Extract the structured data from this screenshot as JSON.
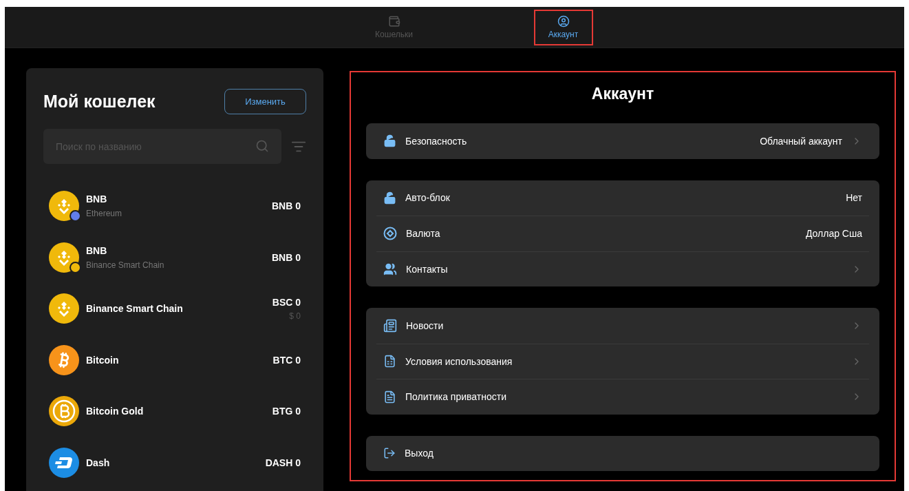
{
  "nav_tabs": [
    {
      "label": "Кошельки",
      "selected": false,
      "highlighted": false
    },
    {
      "label": "Аккаунт",
      "selected": true,
      "highlighted": true
    }
  ],
  "wallet": {
    "title": "Мой кошелек",
    "edit_button": "Изменить",
    "search": {
      "placeholder": "Поиск по названию"
    },
    "coins": [
      {
        "kind": "bnb-eth",
        "name": "BNB",
        "network": "Ethereum",
        "amount": "BNB 0"
      },
      {
        "kind": "bnb-bsc",
        "name": "BNB",
        "network": "Binance Smart Chain",
        "amount": "BNB 0"
      },
      {
        "kind": "bnb",
        "name": "Binance Smart Chain",
        "amount": "BSC 0",
        "fiat": "$ 0"
      },
      {
        "kind": "btc",
        "name": "Bitcoin",
        "amount": "BTC 0"
      },
      {
        "kind": "btg",
        "name": "Bitcoin Gold",
        "amount": "BTG 0"
      },
      {
        "kind": "dash",
        "name": "Dash",
        "amount": "DASH 0"
      }
    ]
  },
  "account": {
    "title": "Аккаунт",
    "highlighted": true,
    "groups": [
      [
        {
          "kind": "lock",
          "label": "Безопасность",
          "value": "Облачный аккаунт",
          "chevron": true
        }
      ],
      [
        {
          "kind": "lock",
          "label": "Авто-блок",
          "value": "Нет",
          "chevron": false
        },
        {
          "kind": "currency",
          "label": "Валюта",
          "value": "Доллар Сша",
          "chevron": false
        },
        {
          "kind": "users",
          "label": "Контакты",
          "chevron": true
        }
      ],
      [
        {
          "kind": "news",
          "label": "Новости",
          "chevron": true
        },
        {
          "kind": "terms",
          "label": "Условия использования",
          "chevron": true
        },
        {
          "kind": "doc",
          "label": "Политика приватности",
          "chevron": true
        }
      ],
      [
        {
          "kind": "logout",
          "label": "Выход",
          "chevron": false
        }
      ]
    ]
  }
}
